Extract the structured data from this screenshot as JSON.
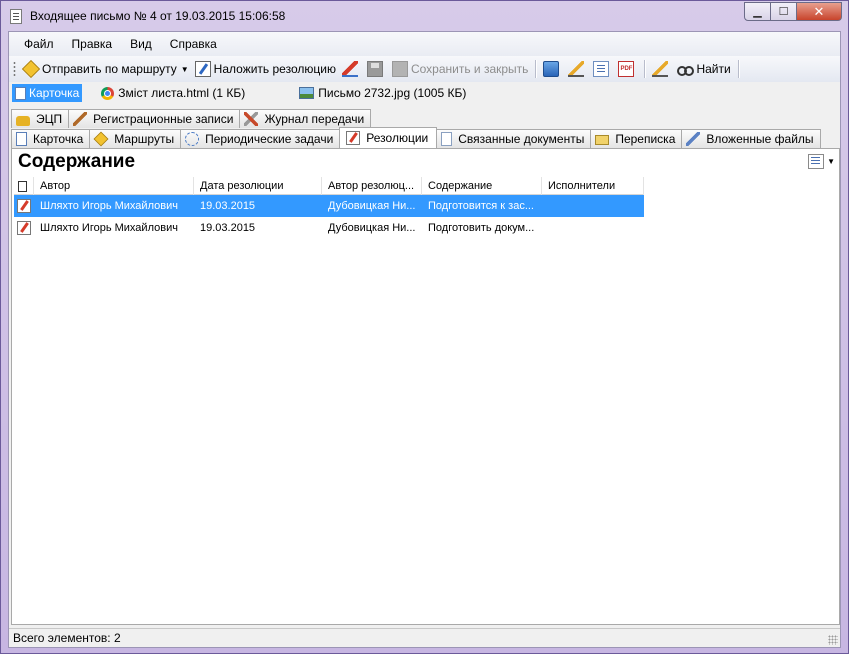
{
  "window": {
    "title": "Входящее письмо № 4 от 19.03.2015 15:06:58",
    "buttons": {
      "minimize": "▁",
      "maximize": "☐",
      "close": "✕"
    }
  },
  "menu": [
    "Файл",
    "Правка",
    "Вид",
    "Справка"
  ],
  "toolbar": {
    "send_route": "Отправить по маршруту",
    "impose_resolution": "Наложить резолюцию",
    "save_close": "Сохранить и закрыть",
    "find": "Найти",
    "pdf_icon_text": "PDF"
  },
  "attachments": [
    {
      "label": "Карточка",
      "icon": "card-icon",
      "active": true
    },
    {
      "label": "Зміст листа.html (1 КБ)",
      "icon": "chrome-icon",
      "active": false
    },
    {
      "label": "Письмо 2732.jpg (1005 КБ)",
      "icon": "image-icon",
      "active": false
    }
  ],
  "tabs_row1": [
    {
      "label": "ЭЦП",
      "icon": "lock-icon"
    },
    {
      "label": "Регистрационные записи",
      "icon": "brush-icon"
    },
    {
      "label": "Журнал передачи",
      "icon": "tools-icon"
    }
  ],
  "tabs_row2": [
    {
      "label": "Карточка",
      "icon": "card-icon"
    },
    {
      "label": "Маршруты",
      "icon": "route-icon"
    },
    {
      "label": "Периодические задачи",
      "icon": "task-icon"
    },
    {
      "label": "Резолюции",
      "icon": "resolution-icon",
      "active": true
    },
    {
      "label": "Связанные документы",
      "icon": "document-icon"
    },
    {
      "label": "Переписка",
      "icon": "mail-icon"
    },
    {
      "label": "Вложенные файлы",
      "icon": "paperclip-icon"
    }
  ],
  "panel": {
    "title": "Содержание",
    "columns": [
      "Автор",
      "Дата резолюции",
      "Автор резолюц...",
      "Содержание",
      "Исполнители"
    ],
    "rows": [
      {
        "author": "Шляхто Игорь Михайлович",
        "date": "19.03.2015",
        "res_author": "Дубовицкая Ни...",
        "content": "Подготовится к зас...",
        "executors": "",
        "selected": true
      },
      {
        "author": "Шляхто Игорь Михайлович",
        "date": "19.03.2015",
        "res_author": "Дубовицкая Ни...",
        "content": "Подготовить докум...",
        "executors": "",
        "selected": false
      }
    ]
  },
  "status": {
    "text": "Всего элементов: 2"
  },
  "colors": {
    "selection": "#3399ff",
    "title_bar": "#c7b6e2"
  }
}
